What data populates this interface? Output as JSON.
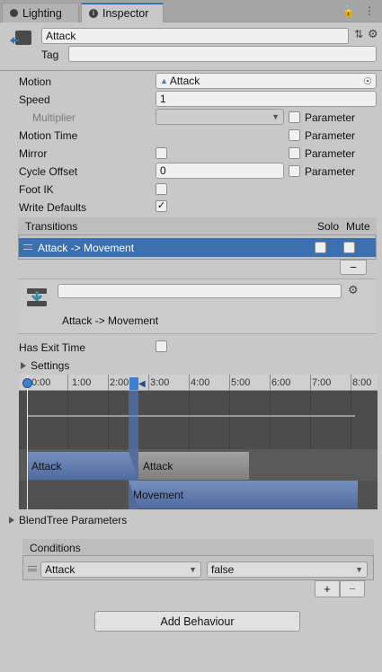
{
  "tabs": [
    {
      "label": "Lighting",
      "icon": "bulb-icon"
    },
    {
      "label": "Inspector",
      "icon": "info-icon",
      "active": true
    }
  ],
  "header": {
    "name_value": "Attack",
    "tag_label": "Tag",
    "tag_value": ""
  },
  "fields": {
    "motion_label": "Motion",
    "motion_value": "Attack",
    "speed_label": "Speed",
    "speed_value": "1",
    "multiplier_label": "Multiplier",
    "motion_time_label": "Motion Time",
    "mirror_label": "Mirror",
    "cycle_offset_label": "Cycle Offset",
    "cycle_offset_value": "0",
    "foot_ik_label": "Foot IK",
    "write_defaults_label": "Write Defaults",
    "parameter_label": "Parameter"
  },
  "transitions": {
    "header": "Transitions",
    "solo": "Solo",
    "mute": "Mute",
    "row_label": "Attack -> Movement",
    "remove_label": "−"
  },
  "detail": {
    "name_value": "",
    "title": "Attack -> Movement"
  },
  "exit": {
    "has_exit_time_label": "Has Exit Time",
    "settings_label": "Settings"
  },
  "timeline": {
    "ticks": [
      "0:00",
      "1:00",
      "2:00",
      "3:00",
      "4:00",
      "5:00",
      "6:00",
      "7:00",
      "8:00"
    ],
    "clip_a1": "Attack",
    "clip_a2": "Attack",
    "clip_m": "Movement"
  },
  "blendtree_label": "BlendTree Parameters",
  "conditions": {
    "header": "Conditions",
    "param_value": "Attack",
    "bool_value": "false",
    "add_label": "+",
    "remove_label": "−"
  },
  "add_behaviour_label": "Add Behaviour",
  "colors": {
    "selection": "#3a6fb0",
    "timeline_bg": "#4c4c4c",
    "clip_blue": "#5577a8",
    "clip_gray": "#8d8d8d"
  }
}
